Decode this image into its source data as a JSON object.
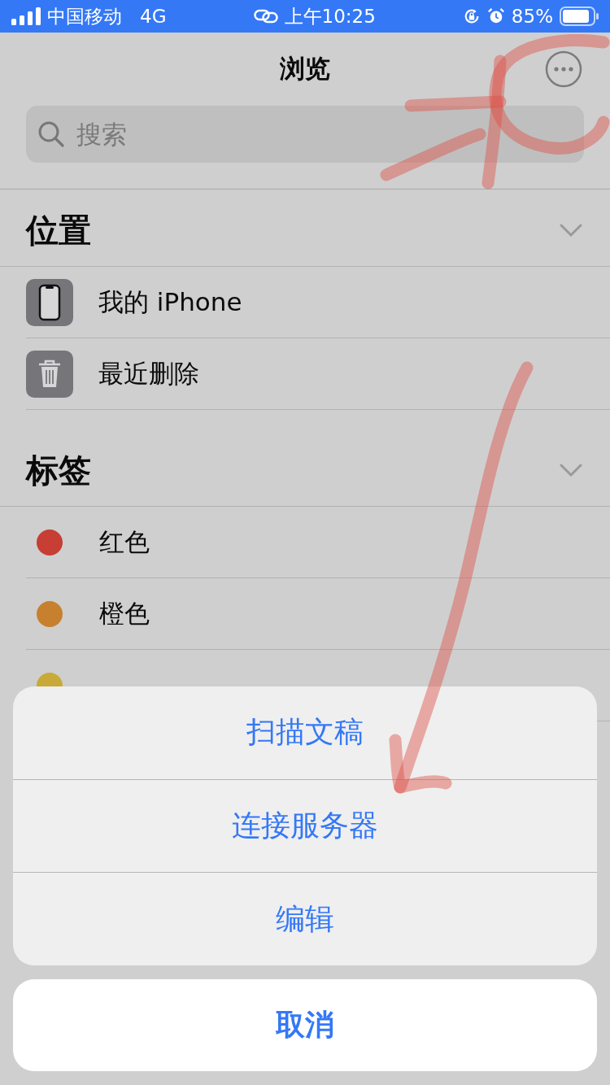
{
  "status_bar": {
    "carrier": "中国移动",
    "network": "4G",
    "time": "上午10:25",
    "battery": "85%"
  },
  "nav": {
    "title": "浏览"
  },
  "search": {
    "placeholder": "搜索"
  },
  "sections": [
    {
      "title": "位置",
      "kind": "locations",
      "items": [
        {
          "label": "我的 iPhone"
        },
        {
          "label": "最近删除"
        }
      ]
    },
    {
      "title": "标签",
      "kind": "tags",
      "items": [
        {
          "label": "红色",
          "color": "#c63e34"
        },
        {
          "label": "橙色",
          "color": "#c7802e"
        },
        {
          "color": "#c9aa38"
        }
      ]
    }
  ],
  "action_sheet": {
    "actions": [
      "扫描文稿",
      "连接服务器",
      "编辑"
    ],
    "cancel": "取消"
  }
}
